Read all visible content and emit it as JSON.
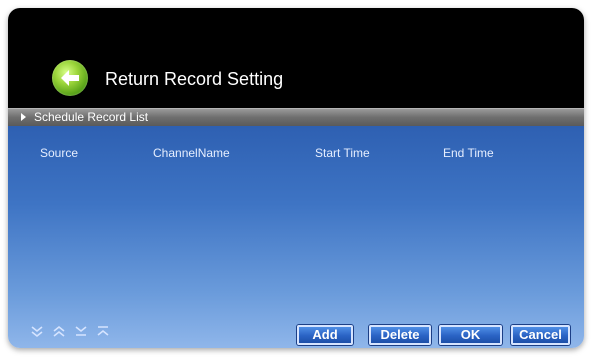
{
  "header": {
    "back_icon": "back-arrow-icon",
    "title": "Return Record Setting"
  },
  "section": {
    "label": "Schedule Record List",
    "arrow_icon": "triangle-right-icon"
  },
  "table": {
    "columns": [
      "Source",
      "ChannelName",
      "Start Time",
      "End Time"
    ],
    "rows": []
  },
  "pagination": {
    "icons": [
      "page-down-icon",
      "page-up-icon",
      "last-page-icon",
      "first-page-icon"
    ]
  },
  "buttons": {
    "add": "Add",
    "delete": "Delete",
    "ok": "OK",
    "cancel": "Cancel"
  },
  "colors": {
    "header_bg": "#000000",
    "content_top": "#2e60b2",
    "content_bottom": "#8fb6ea",
    "back_button": "#6fb62a",
    "button_bg": "#2a63c4",
    "button_border": "#d6e4ff"
  }
}
